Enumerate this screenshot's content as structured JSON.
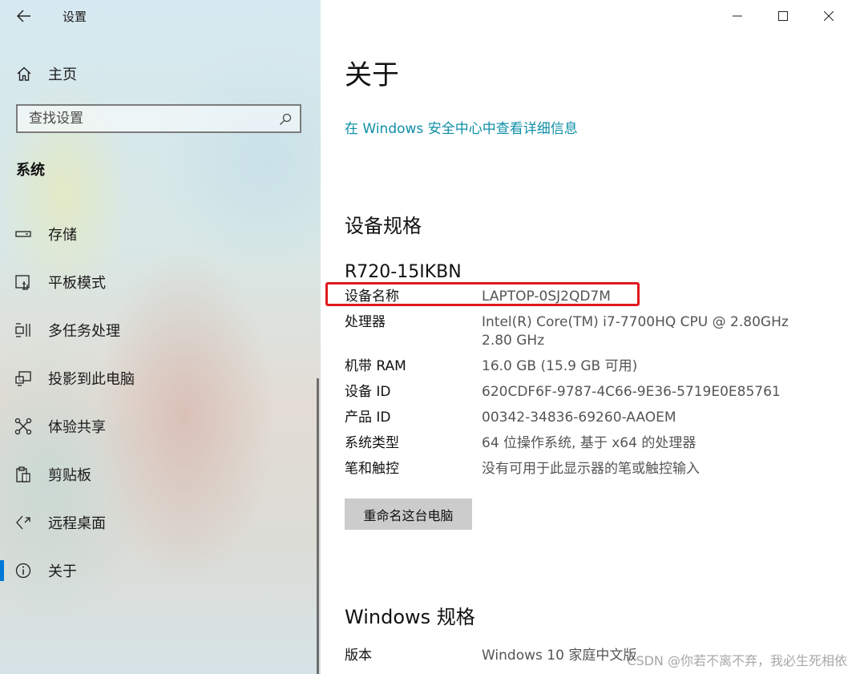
{
  "window": {
    "app_title": "设置",
    "controls": [
      "minimize-icon",
      "maximize-icon",
      "close-icon"
    ]
  },
  "sidebar": {
    "home_label": "主页",
    "search_placeholder": "查找设置",
    "section_title": "系统",
    "items": [
      {
        "label": "存储",
        "icon": "storage-icon"
      },
      {
        "label": "平板模式",
        "icon": "tablet-mode-icon"
      },
      {
        "label": "多任务处理",
        "icon": "multitasking-icon"
      },
      {
        "label": "投影到此电脑",
        "icon": "projecting-icon"
      },
      {
        "label": "体验共享",
        "icon": "shared-experiences-icon"
      },
      {
        "label": "剪贴板",
        "icon": "clipboard-icon"
      },
      {
        "label": "远程桌面",
        "icon": "remote-desktop-icon"
      },
      {
        "label": "关于",
        "icon": "about-icon",
        "active": true
      }
    ]
  },
  "main": {
    "title": "关于",
    "security_link": "在 Windows 安全中心中查看详细信息",
    "device_specs": {
      "heading": "设备规格",
      "model": "R720-15IKBN",
      "rows": [
        {
          "key": "设备名称",
          "value": "LAPTOP-0SJ2QD7M"
        },
        {
          "key": "处理器",
          "value": "Intel(R) Core(TM) i7-7700HQ CPU @ 2.80GHz",
          "value_line2": "2.80 GHz"
        },
        {
          "key": "机带 RAM",
          "value": "16.0 GB (15.9 GB 可用)"
        },
        {
          "key": "设备 ID",
          "value": "620CDF6F-9787-4C66-9E36-5719E0E85761"
        },
        {
          "key": "产品 ID",
          "value": "00342-34836-69260-AAOEM"
        },
        {
          "key": "系统类型",
          "value": "64 位操作系统, 基于 x64 的处理器"
        },
        {
          "key": "笔和触控",
          "value": "没有可用于此显示器的笔或触控输入"
        }
      ],
      "rename_button": "重命名这台电脑"
    },
    "windows_specs": {
      "heading": "Windows 规格",
      "rows": [
        {
          "key": "版本",
          "value": "Windows 10 家庭中文版"
        }
      ]
    },
    "watermark": "CSDN @你若不离不弃，我必生死相依"
  },
  "colors": {
    "accent": "#0078d7",
    "link": "#0f8fa8",
    "highlight": "#e0191e",
    "button_bg": "#cccccc"
  }
}
